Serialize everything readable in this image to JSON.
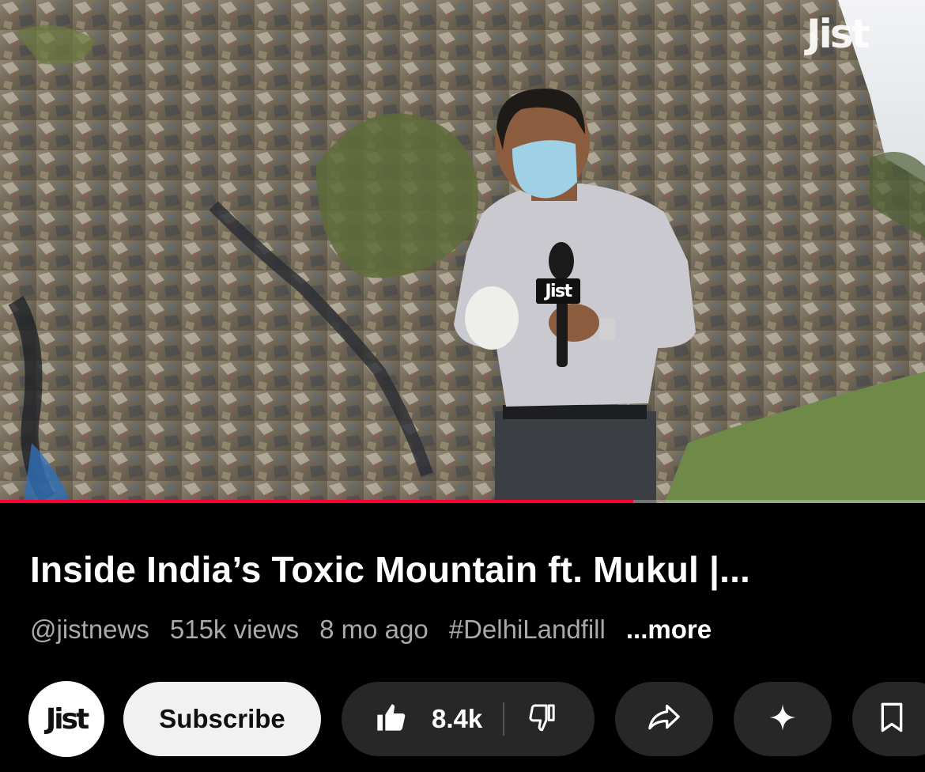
{
  "video": {
    "watermark": "Jist",
    "mic_flag_text": "Jist",
    "progress_fraction": 0.685,
    "accent_color": "#ff0033"
  },
  "title": "Inside India’s Toxic Mountain ft. Mukul  |...",
  "meta": {
    "channel_handle": "@jistnews",
    "views": "515k views",
    "age": "8 mo ago",
    "hashtag": "#DelhiLandfill",
    "more_label": "...more"
  },
  "actions": {
    "avatar_text": "Jist",
    "subscribe_label": "Subscribe",
    "like_count": "8.4k",
    "icons": [
      "thumbs-up-icon",
      "thumbs-down-icon",
      "share-icon",
      "sparkle-icon",
      "bookmark-icon"
    ]
  }
}
